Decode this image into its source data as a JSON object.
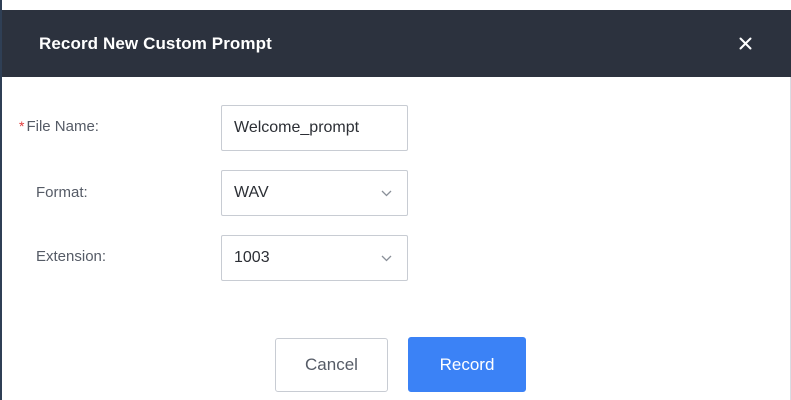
{
  "dialog": {
    "title": "Record New Custom Prompt",
    "close_icon": "close-icon"
  },
  "form": {
    "file_name": {
      "required_mark": "*",
      "label": "File Name:",
      "value": "Welcome_prompt"
    },
    "format": {
      "label": "Format:",
      "value": "WAV",
      "icon": "chevron-down-icon"
    },
    "extension": {
      "label": "Extension:",
      "value": "1003",
      "icon": "chevron-down-icon"
    }
  },
  "actions": {
    "cancel_label": "Cancel",
    "record_label": "Record"
  },
  "colors": {
    "header_bg": "#2c323e",
    "primary": "#3b82f6",
    "required": "#e03b3b"
  }
}
